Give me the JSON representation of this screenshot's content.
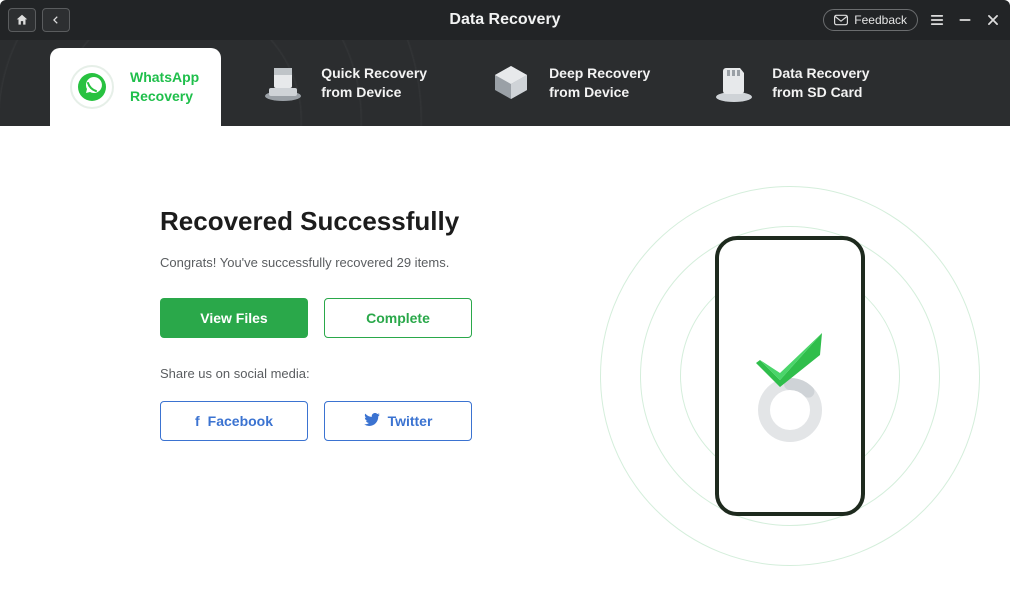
{
  "header": {
    "title": "Data Recovery",
    "feedback_label": "Feedback"
  },
  "tabs": [
    {
      "label_l1": "WhatsApp",
      "label_l2": "Recovery",
      "active": true
    },
    {
      "label_l1": "Quick Recovery",
      "label_l2": "from Device",
      "active": false
    },
    {
      "label_l1": "Deep Recovery",
      "label_l2": "from Device",
      "active": false
    },
    {
      "label_l1": "Data Recovery",
      "label_l2": "from SD Card",
      "active": false
    }
  ],
  "result": {
    "title": "Recovered Successfully",
    "subtitle": "Congrats! You've successfully recovered 29 items.",
    "view_files_label": "View Files",
    "complete_label": "Complete",
    "share_label": "Share us on social media:",
    "facebook_label": "Facebook",
    "twitter_label": "Twitter"
  }
}
